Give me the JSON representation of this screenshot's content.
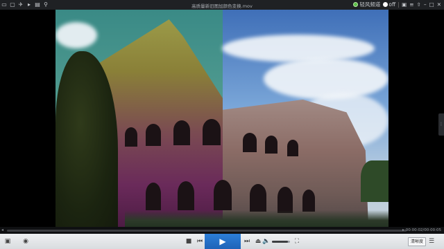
{
  "titlebar": {
    "title": "高质量新旧图加颜色变换.mov",
    "tool_icons": [
      "folder-icon",
      "window-icon",
      "send-icon",
      "play-small-icon",
      "film-icon",
      "pin-icon"
    ],
    "channel_label": "轻风频道",
    "toggle_label": "off",
    "right_icons": [
      "skin-icon",
      "menu-icon",
      "font-icon",
      "minimize-icon",
      "maximize-icon",
      "close-icon"
    ]
  },
  "player": {
    "progress_fraction": 0.0,
    "time_label": "00:00:02/00:00:05",
    "volume_fraction": 0.9,
    "quality_label": "清晰度"
  },
  "colors": {
    "accent": "#1e63b8",
    "progress": "#3d8be0"
  }
}
